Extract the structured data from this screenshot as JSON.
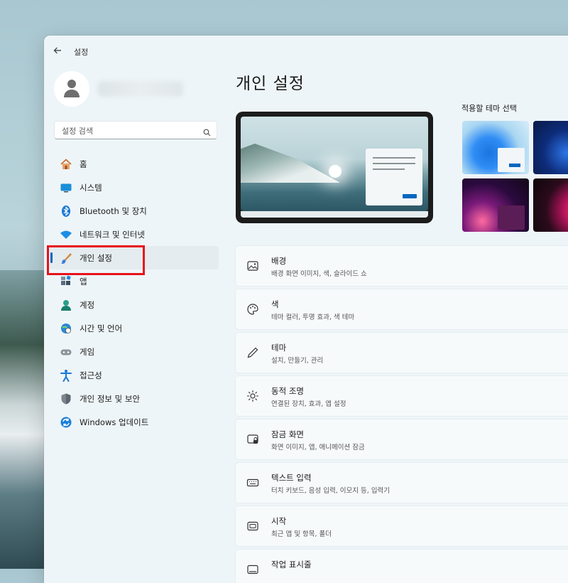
{
  "window": {
    "title": "설정"
  },
  "sidebar": {
    "search_placeholder": "설정 검색",
    "items": [
      {
        "label": "홈"
      },
      {
        "label": "시스템"
      },
      {
        "label": "Bluetooth 및 장치"
      },
      {
        "label": "네트워크 및 인터넷"
      },
      {
        "label": "개인 설정",
        "selected": true
      },
      {
        "label": "앱"
      },
      {
        "label": "계정"
      },
      {
        "label": "시간 및 언어"
      },
      {
        "label": "게임"
      },
      {
        "label": "접근성"
      },
      {
        "label": "개인 정보 및 보안"
      },
      {
        "label": "Windows 업데이트"
      }
    ]
  },
  "main": {
    "title": "개인 설정",
    "theme_label": "적용할 테마 선택",
    "rows": [
      {
        "title": "배경",
        "subtitle": "배경 화면 이미지, 색, 슬라이드 쇼"
      },
      {
        "title": "색",
        "subtitle": "테마 컬러, 투명 효과, 색 테마"
      },
      {
        "title": "테마",
        "subtitle": "설치, 만들기, 관리"
      },
      {
        "title": "동적 조명",
        "subtitle": "연결된 장치, 효과, 앱 설정"
      },
      {
        "title": "잠금 화면",
        "subtitle": "화면 이미지, 앱, 애니메이션 잠금"
      },
      {
        "title": "텍스트 입력",
        "subtitle": "터치 키보드, 음성 입력, 이모지 등, 입력기"
      },
      {
        "title": "시작",
        "subtitle": "최근 앱 및 항목, 폴더"
      },
      {
        "title": "작업 표시줄",
        "subtitle": ""
      }
    ]
  },
  "colors": {
    "accent": "#0067c0",
    "highlight_box": "#e8131b"
  }
}
